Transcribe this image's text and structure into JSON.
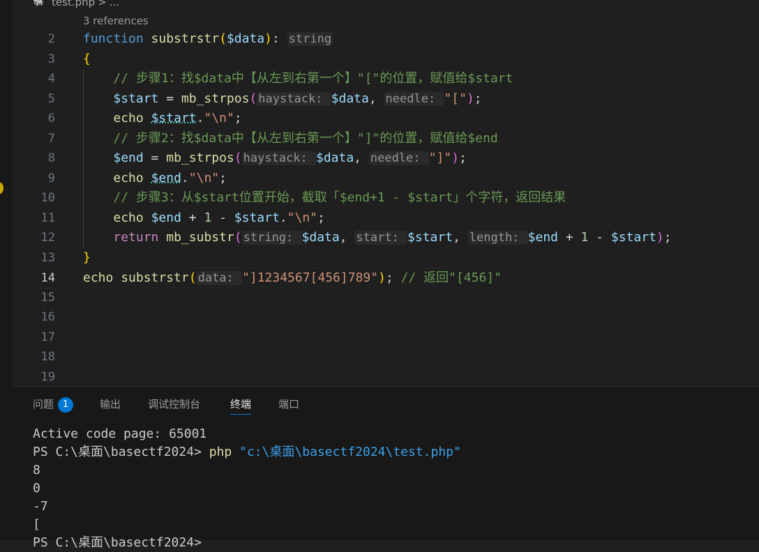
{
  "breadcrumb": {
    "file": "test.php",
    "separator": ">",
    "ellipsis": "..."
  },
  "codelens": "3 references",
  "editor": {
    "active_line": "14",
    "lines": [
      {
        "n": "2",
        "tokens": [
          [
            "kw",
            "function"
          ],
          [
            "op",
            " "
          ],
          [
            "fn",
            "substrstr"
          ],
          [
            "b1",
            "("
          ],
          [
            "var",
            "$data"
          ],
          [
            "b1",
            ")"
          ],
          [
            "op",
            ": "
          ],
          [
            "hint_plain",
            "string"
          ]
        ]
      },
      {
        "n": "3",
        "tokens": [
          [
            "b1",
            "{"
          ]
        ]
      },
      {
        "n": "4",
        "tokens": [
          [
            "op",
            "    "
          ],
          [
            "cm",
            "// 步骤1：找$data中【从左到右第一个】\"[\"的位置，赋值给$start"
          ]
        ]
      },
      {
        "n": "5",
        "tokens": [
          [
            "op",
            "    "
          ],
          [
            "var",
            "$start"
          ],
          [
            "op",
            " = "
          ],
          [
            "fn",
            "mb_strpos"
          ],
          [
            "b2",
            "("
          ],
          [
            "hint",
            "haystack: "
          ],
          [
            "var",
            "$data"
          ],
          [
            "op",
            ", "
          ],
          [
            "hint",
            "needle: "
          ],
          [
            "str",
            "\"[\""
          ],
          [
            "b2",
            ")"
          ],
          [
            "op",
            ";"
          ]
        ]
      },
      {
        "n": "6",
        "tokens": [
          [
            "op",
            "    "
          ],
          [
            "fn",
            "echo"
          ],
          [
            "op",
            " "
          ],
          [
            "varsq",
            "$start"
          ],
          [
            "op",
            "."
          ],
          [
            "str",
            "\"\\n\""
          ],
          [
            "op",
            ";"
          ]
        ]
      },
      {
        "n": "7",
        "tokens": [
          [
            "op",
            "    "
          ],
          [
            "cm",
            "// 步骤2：找$data中【从左到右第一个】\"]\"的位置，赋值给$end"
          ]
        ]
      },
      {
        "n": "8",
        "tokens": [
          [
            "op",
            "    "
          ],
          [
            "var",
            "$end"
          ],
          [
            "op",
            " = "
          ],
          [
            "fn",
            "mb_strpos"
          ],
          [
            "b2",
            "("
          ],
          [
            "hint",
            "haystack: "
          ],
          [
            "var",
            "$data"
          ],
          [
            "op",
            ", "
          ],
          [
            "hint",
            "needle: "
          ],
          [
            "str",
            "\"]\""
          ],
          [
            "b2",
            ")"
          ],
          [
            "op",
            ";"
          ]
        ]
      },
      {
        "n": "9",
        "tokens": [
          [
            "op",
            "    "
          ],
          [
            "fn",
            "echo"
          ],
          [
            "op",
            " "
          ],
          [
            "varsq",
            "$end"
          ],
          [
            "op",
            "."
          ],
          [
            "str",
            "\"\\n\""
          ],
          [
            "op",
            ";"
          ]
        ]
      },
      {
        "n": "10",
        "tokens": [
          [
            "op",
            "    "
          ],
          [
            "cm",
            "// 步骤3：从$start位置开始，截取「$end+1 - $start」个字符，返回结果"
          ]
        ]
      },
      {
        "n": "11",
        "tokens": [
          [
            "op",
            "    "
          ],
          [
            "fn",
            "echo"
          ],
          [
            "op",
            " "
          ],
          [
            "var",
            "$end"
          ],
          [
            "op",
            " + "
          ],
          [
            "num",
            "1"
          ],
          [
            "op",
            " - "
          ],
          [
            "var",
            "$start"
          ],
          [
            "op",
            "."
          ],
          [
            "str",
            "\"\\n\""
          ],
          [
            "op",
            ";"
          ]
        ]
      },
      {
        "n": "12",
        "tokens": [
          [
            "op",
            "    "
          ],
          [
            "kw2",
            "return"
          ],
          [
            "op",
            " "
          ],
          [
            "fn",
            "mb_substr"
          ],
          [
            "b2",
            "("
          ],
          [
            "hint",
            "string: "
          ],
          [
            "var",
            "$data"
          ],
          [
            "op",
            ", "
          ],
          [
            "hint",
            "start: "
          ],
          [
            "var",
            "$start"
          ],
          [
            "op",
            ", "
          ],
          [
            "hint",
            "length: "
          ],
          [
            "var",
            "$end"
          ],
          [
            "op",
            " + "
          ],
          [
            "num",
            "1"
          ],
          [
            "op",
            " - "
          ],
          [
            "var",
            "$start"
          ],
          [
            "b2",
            ")"
          ],
          [
            "op",
            ";"
          ]
        ]
      },
      {
        "n": "13",
        "tokens": [
          [
            "b1",
            "}"
          ]
        ]
      },
      {
        "n": "14",
        "tokens": [
          [
            "fn",
            "echo"
          ],
          [
            "op",
            " "
          ],
          [
            "fn",
            "substrstr"
          ],
          [
            "b1",
            "("
          ],
          [
            "hint",
            "data: "
          ],
          [
            "str",
            "\"]1234567[456]789\""
          ],
          [
            "b1",
            ")"
          ],
          [
            "op",
            "; "
          ],
          [
            "cm",
            "// 返回\"[456]\""
          ]
        ]
      },
      {
        "n": "15",
        "tokens": []
      },
      {
        "n": "16",
        "tokens": []
      },
      {
        "n": "17",
        "tokens": []
      },
      {
        "n": "18",
        "tokens": []
      },
      {
        "n": "19",
        "tokens": []
      }
    ]
  },
  "panel": {
    "tabs": [
      {
        "label": "问题",
        "badge": "1",
        "active": false
      },
      {
        "label": "输出",
        "active": false
      },
      {
        "label": "调试控制台",
        "active": false
      },
      {
        "label": "终端",
        "active": true
      },
      {
        "label": "端口",
        "active": false
      }
    ],
    "terminal": {
      "line1": "Active code page: 65001",
      "prompt": "PS C:\\桌面\\basectf2024> ",
      "cmd": "php",
      "arg": "\"c:\\桌面\\basectf2024\\test.php\"",
      "out1": "8",
      "out2": "0",
      "out3": "-7",
      "out4": "[",
      "next_prompt": "PS C:\\桌面\\basectf2024>"
    }
  },
  "colors": {
    "accent": "#0078d4",
    "background": "#1f1f1f",
    "panel": "#181818"
  }
}
